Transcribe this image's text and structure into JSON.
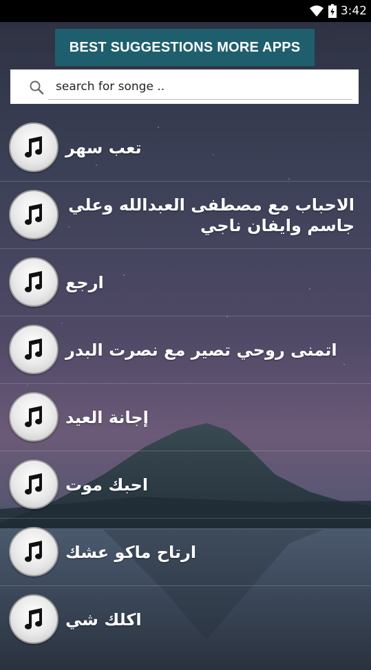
{
  "status_bar": {
    "time": "3:42",
    "icons": [
      "wifi-icon",
      "battery-icon"
    ]
  },
  "banner": {
    "label": "BEST SUGGESTIONS MORE APPS"
  },
  "search": {
    "placeholder": "search for songe ..",
    "icon": "search-icon"
  },
  "songs": [
    {
      "title": "تعب سهر",
      "icon": "music-note-icon"
    },
    {
      "title": "الاحباب مع مصطفى العبدالله وعلي جاسم وايفان ناجي",
      "icon": "music-note-icon"
    },
    {
      "title": "ارجع",
      "icon": "music-note-icon"
    },
    {
      "title": "اتمنى روحي تصير مع نصرت البدر",
      "icon": "music-note-icon"
    },
    {
      "title": "إجانة العيد",
      "icon": "music-note-icon"
    },
    {
      "title": "احبك موت",
      "icon": "music-note-icon"
    },
    {
      "title": "ارتاح ماكو عشك",
      "icon": "music-note-icon"
    },
    {
      "title": "اكلك شي",
      "icon": "music-note-icon"
    }
  ],
  "colors": {
    "banner_bg": "#1f5f6d",
    "status_bar_bg": "#000000",
    "text": "#ffffff"
  }
}
